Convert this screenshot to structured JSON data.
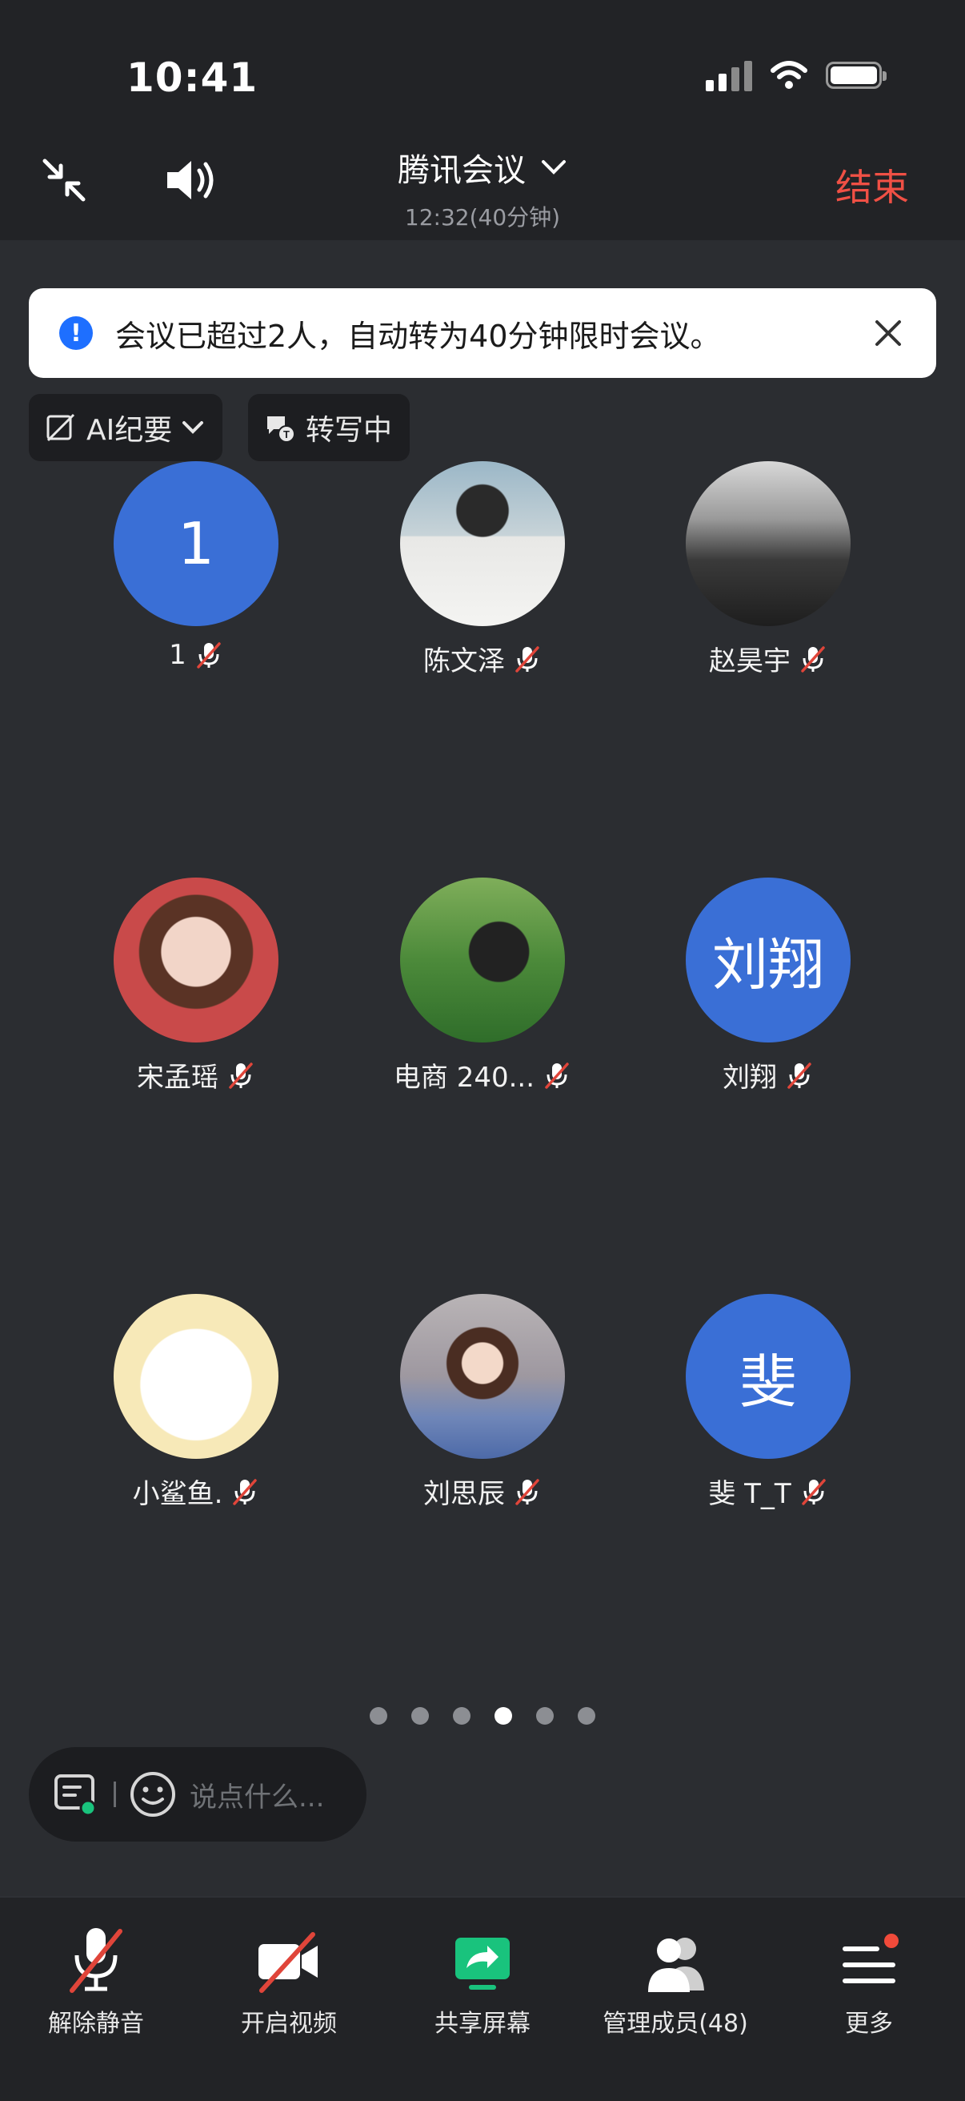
{
  "status_bar": {
    "time": "10:41"
  },
  "header": {
    "title": "腾讯会议",
    "subtitle": "12:32(40分钟)",
    "end_label": "结束"
  },
  "notice": {
    "text": "会议已超过2人，自动转为40分钟限时会议。"
  },
  "chips": {
    "ai_summary": "AI纪要",
    "transcribing": "转写中"
  },
  "participants": [
    {
      "name": "1",
      "avatar_text": "1",
      "avatar_type": "text",
      "muted": true
    },
    {
      "name": "陈文泽",
      "avatar_type": "photo",
      "muted": true
    },
    {
      "name": "赵昊宇",
      "avatar_type": "photo",
      "muted": true
    },
    {
      "name": "宋孟瑶",
      "avatar_type": "photo",
      "muted": true
    },
    {
      "name": "电商 240...",
      "avatar_type": "photo",
      "muted": true
    },
    {
      "name": "刘翔",
      "avatar_text": "刘翔",
      "avatar_type": "text",
      "muted": true
    },
    {
      "name": "小鲨鱼.",
      "avatar_type": "photo",
      "muted": true
    },
    {
      "name": "刘思辰",
      "avatar_type": "photo",
      "muted": true
    },
    {
      "name": "斐 T_T",
      "avatar_text": "斐",
      "avatar_type": "text",
      "muted": true
    }
  ],
  "pagination": {
    "total": 6,
    "active_index": 3
  },
  "chat": {
    "placeholder": "说点什么..."
  },
  "toolbar": {
    "unmute": "解除静音",
    "start_video": "开启视频",
    "share_screen": "共享屏幕",
    "manage_members": "管理成员(48)",
    "more": "更多"
  },
  "colors": {
    "background": "#2b2d31",
    "bar": "#222326",
    "end_red": "#f05045",
    "avatar_blue": "#3a6fd6",
    "share_green": "#19c37d",
    "mute_red": "#e0453a"
  }
}
